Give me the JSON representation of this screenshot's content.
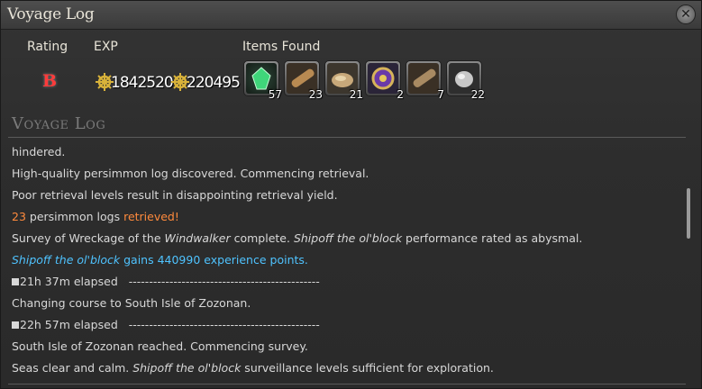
{
  "window": {
    "title": "Voyage Log",
    "close_glyph": "✕"
  },
  "summary": {
    "rating_label": "Rating",
    "exp_label": "EXP",
    "items_label": "Items Found",
    "rating_value": "B",
    "exp_values": [
      "1842520",
      "220495"
    ],
    "items": [
      {
        "name": "green-crystal-icon",
        "qty": "57"
      },
      {
        "name": "log-icon",
        "qty": "23"
      },
      {
        "name": "ore-icon",
        "qty": "21"
      },
      {
        "name": "purple-orb-icon",
        "qty": "2"
      },
      {
        "name": "log-icon",
        "qty": "7"
      },
      {
        "name": "rock-icon",
        "qty": "22"
      }
    ]
  },
  "log": {
    "heading": "Voyage Log",
    "lines": [
      "hindered.",
      "High-quality persimmon log discovered. Commencing retrieval.",
      "Poor retrieval levels result in disappointing retrieval yield.",
      {
        "a": "23",
        "b": " persimmon logs ",
        "c": "retrieved!"
      },
      {
        "a": "Survey of Wreckage of the ",
        "b": "Windwalker",
        "c": " complete. ",
        "d": "Shipoff the ol'block",
        "e": " performance rated as abysmal."
      },
      {
        "a": "Shipoff the ol'block",
        "b": " gains 440990  experience points."
      },
      {
        "a": "21h 37m elapsed",
        "b": "-----------------------------------------------"
      },
      "Changing course to South Isle of Zozonan.",
      {
        "a": "22h 57m elapsed",
        "b": "-----------------------------------------------"
      },
      "South Isle of Zozonan reached. Commencing survey.",
      {
        "a": "Seas clear and calm. ",
        "b": "Shipoff the ol'block",
        "c": " surveillance levels sufficient for exploration."
      }
    ]
  },
  "colors": {
    "rating": "#ff3b3b",
    "highlight_orange": "#ff8a3c",
    "highlight_blue": "#4fc3ff"
  }
}
